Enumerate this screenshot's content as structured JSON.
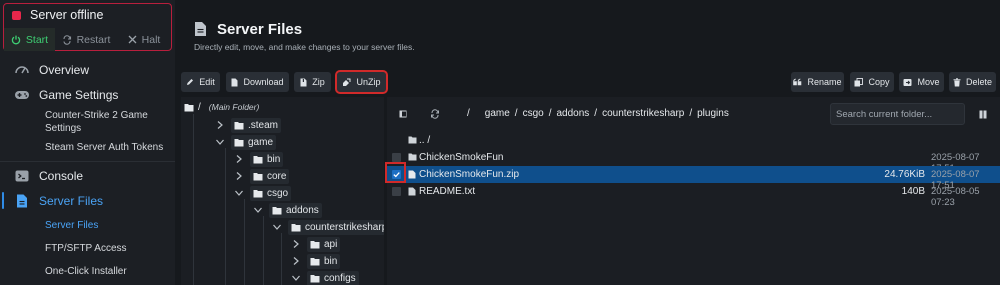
{
  "server_status": {
    "title": "Server offline",
    "status_color": "#e8274b",
    "buttons": {
      "start": "Start",
      "restart": "Restart",
      "halt": "Halt"
    }
  },
  "sidebar": {
    "items": [
      {
        "label": "Overview",
        "icon": "gauge-icon"
      },
      {
        "label": "Game Settings",
        "icon": "gamepad-icon"
      },
      {
        "label": "Console",
        "icon": "terminal-icon"
      },
      {
        "label": "Server Files",
        "icon": "file-icon"
      }
    ],
    "game_settings_sub": [
      "Counter-Strike 2 Game Settings",
      "Steam Server Auth Tokens"
    ],
    "server_files_sub": [
      "Server Files",
      "FTP/SFTP Access",
      "One-Click Installer"
    ]
  },
  "header": {
    "title": "Server Files",
    "subtitle": "Directly edit, move, and make changes to your server files."
  },
  "toolbar": {
    "edit": "Edit",
    "download": "Download",
    "zip": "Zip",
    "unzip": "UnZip",
    "rename": "Rename",
    "copy": "Copy",
    "move": "Move",
    "delete": "Delete"
  },
  "tree": {
    "root": "/",
    "root_note": "(Main Folder)",
    "nodes": [
      ".steam",
      "game",
      "bin",
      "core",
      "csgo",
      "addons",
      "counterstrikesharp",
      "api",
      "bin",
      "configs"
    ]
  },
  "path": {
    "root": "/",
    "segments": [
      "game",
      "csgo",
      "addons",
      "counterstrikesharp",
      "plugins"
    ]
  },
  "search": {
    "placeholder": "Search current folder..."
  },
  "files": [
    {
      "name": ".. /",
      "size": "",
      "date": "",
      "type": "folder"
    },
    {
      "name": "ChickenSmokeFun",
      "size": "",
      "date": "2025-08-07 17:51",
      "type": "folder"
    },
    {
      "name": "ChickenSmokeFun.zip",
      "size": "24.76KiB",
      "date": "2025-08-07 17:51",
      "type": "file",
      "selected": true
    },
    {
      "name": "README.txt",
      "size": "140B",
      "date": "2025-08-05 07:23",
      "type": "file"
    }
  ]
}
